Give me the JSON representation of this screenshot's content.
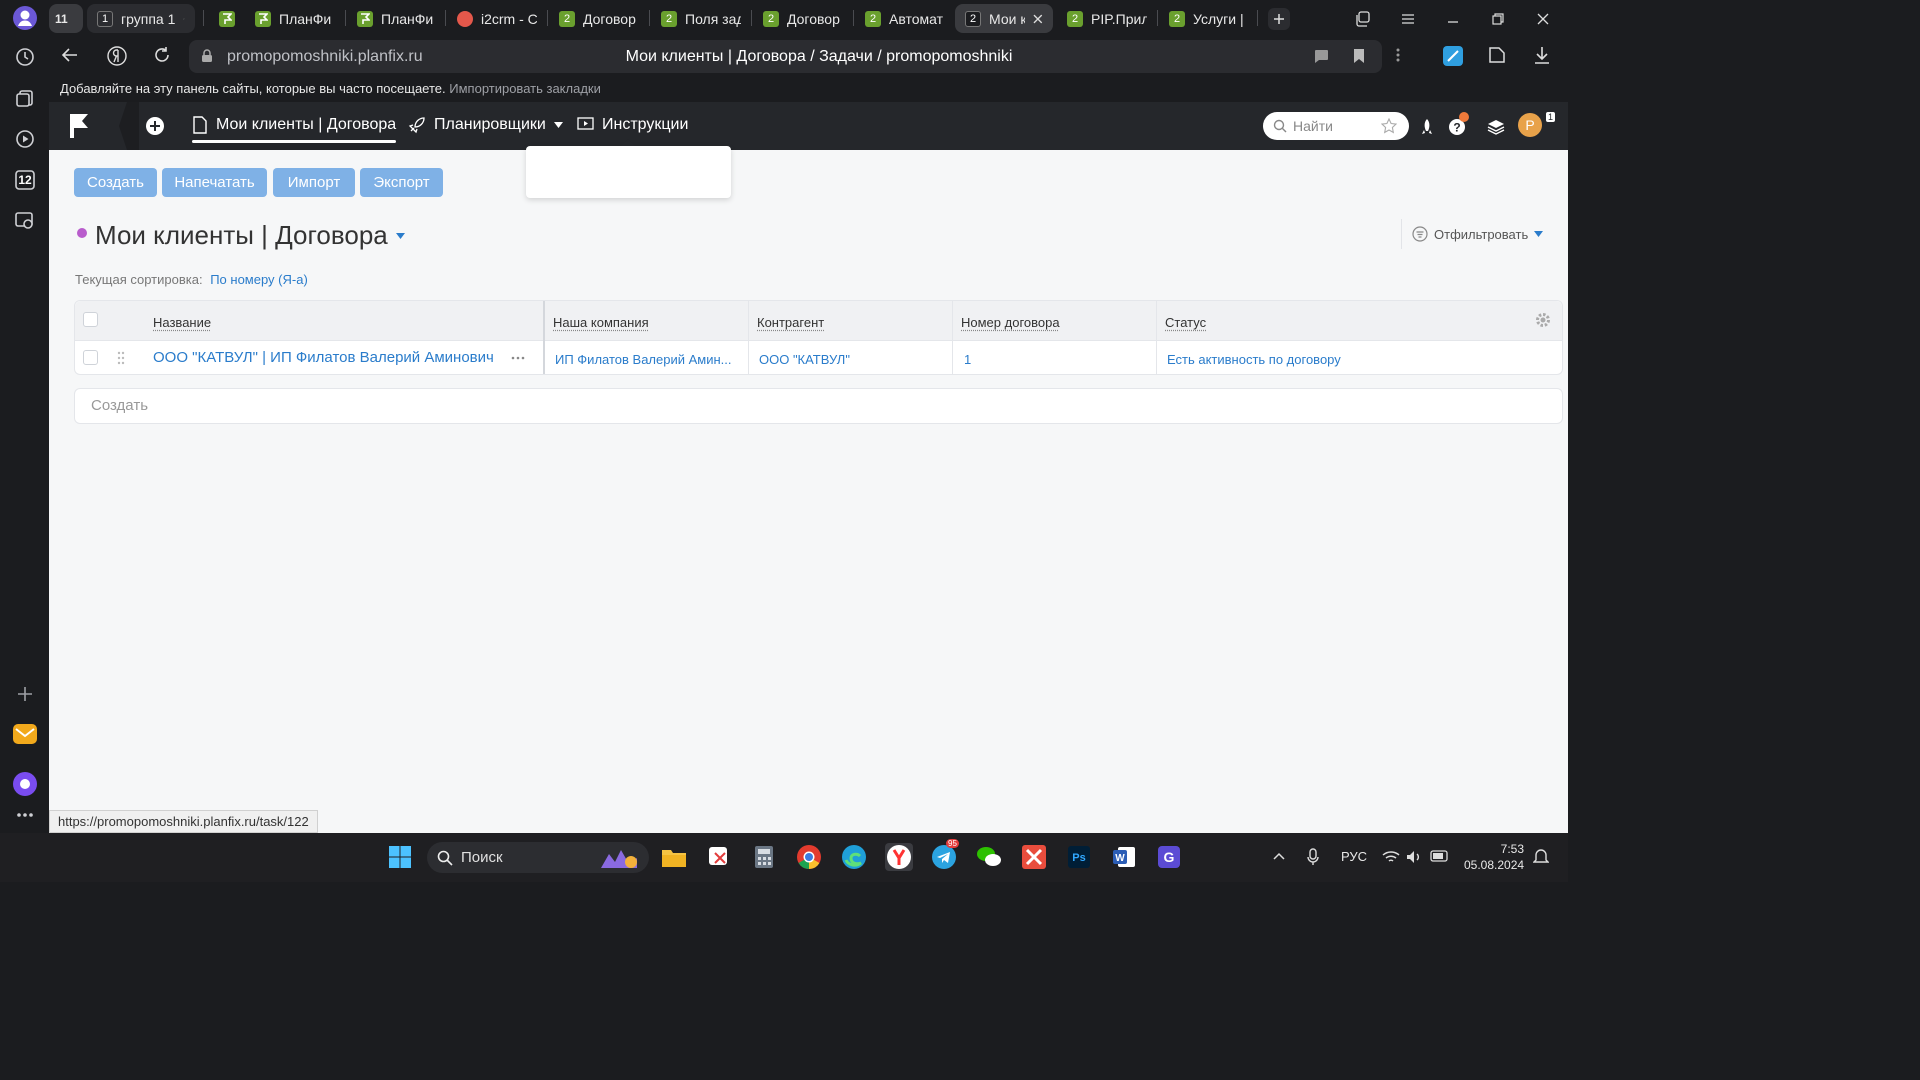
{
  "browser": {
    "tab_group_count": "11",
    "tab_group": {
      "count": "1",
      "label": "группа 1"
    },
    "tabs": [
      {
        "label": "",
        "icon": "planfix-flag-icon"
      },
      {
        "label": "ПланФи",
        "icon": "planfix-flag-icon"
      },
      {
        "label": "ПланФи",
        "icon": "planfix-flag-icon"
      },
      {
        "label": "i2crm - C",
        "icon": "i2crm-icon"
      },
      {
        "label": "Договор",
        "badge": "2"
      },
      {
        "label": "Поля зад",
        "badge": "2"
      },
      {
        "label": "Договор",
        "badge": "2"
      },
      {
        "label": "Автомат",
        "badge": "2"
      },
      {
        "label": "Мои к",
        "badge": "2",
        "active": true
      },
      {
        "label": "PIP.Прил",
        "badge": "2"
      },
      {
        "label": "Услуги |",
        "badge": "2"
      }
    ],
    "url": "promopomoshniki.planfix.ru",
    "page_title": "Мои клиенты | Договора / Задачи / promopomoshniki",
    "bookmarks_hint": "Добавляйте на эту панель сайты, которые вы часто посещаете.",
    "bookmarks_import": "Импортировать закладки",
    "status_url": "https://promopomoshniki.planfix.ru/task/122",
    "rail_badge": "12"
  },
  "header": {
    "nav_active": "Мои клиенты | Договора",
    "nav_planners": "Планировщики",
    "nav_instructions": "Инструкции",
    "search_placeholder": "Найти",
    "avatar_letter": "P",
    "avatar_badge": "1"
  },
  "toolbar": {
    "create": "Создать",
    "print": "Напечатать",
    "import": "Импорт",
    "export": "Экспорт"
  },
  "page": {
    "title": "Мои клиенты | Договора",
    "sort_label": "Текущая сортировка:",
    "sort_value": "По номеру (Я-а)",
    "filter_label": "Отфильтровать"
  },
  "table": {
    "columns": [
      "Название",
      "Наша компания",
      "Контрагент",
      "Номер договора",
      "Статус"
    ],
    "rows": [
      {
        "name": "ООО \"КАТВУЛ\" | ИП Филатов Валерий Аминович",
        "company": "ИП Филатов Валерий Амин...",
        "counterparty": "ООО \"КАТВУЛ\"",
        "number": "1",
        "status": "Есть активность по договору"
      }
    ],
    "new_row_label": "Создать"
  },
  "taskbar": {
    "search_label": "Поиск",
    "lang": "РУС",
    "time": "7:53",
    "date": "05.08.2024",
    "telegram_badge": "95"
  },
  "colors": {
    "accent_button": "#7fb1e6",
    "link": "#2a7ccb",
    "header_bg": "#25272b",
    "status_dot": "#b85ccc"
  }
}
